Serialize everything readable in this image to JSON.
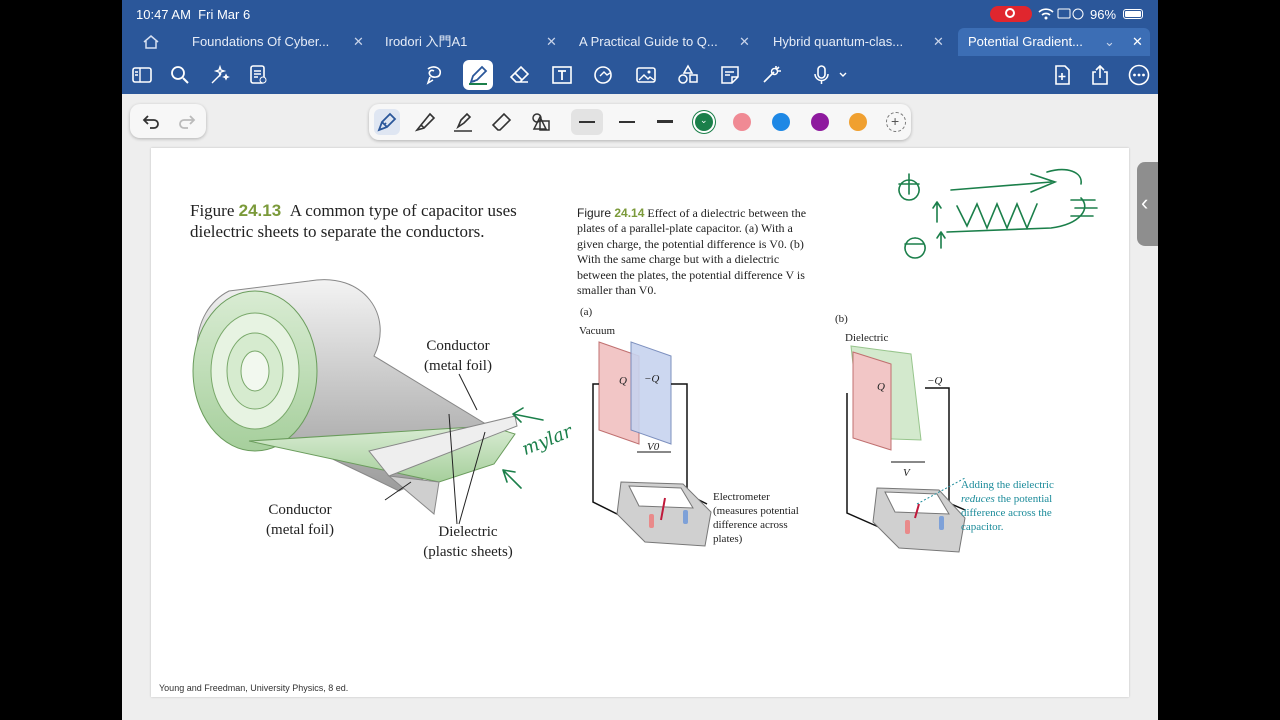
{
  "status": {
    "time": "10:47 AM",
    "date": "Fri Mar 6",
    "battery": "96%"
  },
  "tabs": [
    {
      "label": "Foundations Of Cyber..."
    },
    {
      "label": "Irodori 入門A1"
    },
    {
      "label": "A Practical Guide to Q..."
    },
    {
      "label": "Hybrid quantum-clas..."
    },
    {
      "label": "Potential Gradient..."
    }
  ],
  "icons": {
    "home": "home-icon",
    "close": "close-icon",
    "chevron": "chevron-down-icon",
    "toolbar": [
      "sidebar-icon",
      "search-icon",
      "sparkle-icon",
      "document-list-icon",
      "lasso-icon",
      "pen-icon",
      "eraser-icon",
      "text-box-icon",
      "shapes-icon",
      "image-icon",
      "elements-icon",
      "sticky-note-icon",
      "laser-pointer-icon",
      "microphone-icon",
      "add-page-icon",
      "share-icon",
      "more-icon"
    ],
    "pen_tools": [
      "fountain-pen-icon",
      "highlighter-icon",
      "pencil-icon",
      "eraser-tool-icon",
      "shape-tool-icon"
    ]
  },
  "colors": {
    "accent": "#2b579a",
    "swatches": [
      "#1b7f4a",
      "#f08a94",
      "#1e88e5",
      "#8e1a9e",
      "#f0a030"
    ]
  },
  "page": {
    "fig13": {
      "num": "24.13",
      "prefix": "Figure ",
      "caption": "A common type of capacitor uses dielectric sheets to separate the conductors.",
      "label_conductor_top_1": "Conductor",
      "label_conductor_top_2": "(metal foil)",
      "label_conductor_bottom_1": "Conductor",
      "label_conductor_bottom_2": "(metal foil)",
      "label_dielectric_1": "Dielectric",
      "label_dielectric_2": "(plastic sheets)"
    },
    "fig14": {
      "prefix": "Figure ",
      "num": "24.14",
      "caption": "Effect of a dielectric between the plates of a parallel-plate capacitor. (a) With a given charge, the potential difference is V0. (b) With the same charge but with a dielectric between the plates, the potential difference V is smaller than V0.",
      "part_a": "(a)",
      "part_b": "(b)",
      "vacuum": "Vacuum",
      "dielectric": "Dielectric",
      "q_pos": "Q",
      "q_neg": "−Q",
      "v0": "V0",
      "v": "V",
      "electrometer": "Electrometer (measures potential difference across plates)",
      "note_1": "Adding the dielectric",
      "note_2": "reduces",
      "note_3": "the potential difference across the capacitor."
    },
    "handwriting": "mylar",
    "footer": "Young and Freedman, University Physics, 8 ed."
  }
}
